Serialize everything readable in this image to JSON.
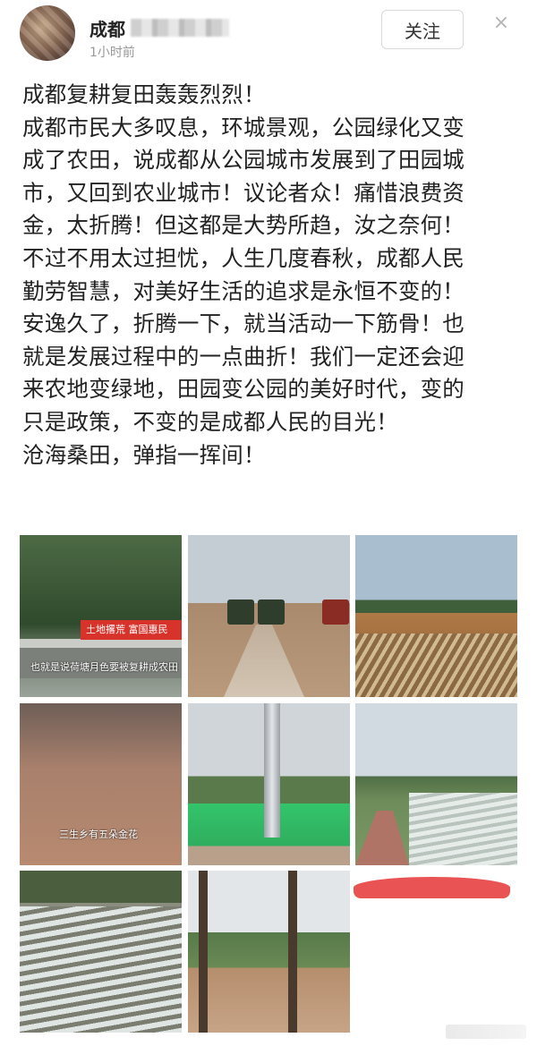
{
  "post": {
    "username": "成都",
    "time": "1小时前",
    "follow_label": "关注",
    "close_glyph": "×"
  },
  "content": {
    "lines": [
      "成都复耕复田轰轰烈烈！",
      "成都市民大多叹息，环城景观，公园绿化又变",
      "成了农田，说成都从公园城市发展到了田园城",
      "市，又回到农业城市！议论者众！痛惜浪费资",
      "金，太折腾！但这都是大势所趋，汝之奈何！",
      "不过不用太过担忧，人生几度春秋，成都人民",
      "勤劳智慧，对美好生活的追求是永恒不变的！",
      "安逸久了，折腾一下，就当活动一下筋骨！也",
      "就是发展过程中的一点曲折！我们一定还会迎",
      "来农地变绿地，田园变公园的美好时代，变的",
      "只是政策，不变的是成都人民的目光！",
      "沧海桑田，弹指一挥间！"
    ]
  },
  "images": {
    "tile1_banner": "土地撂荒 富国惠民",
    "tile1_caption": "也就是说荷塘月色要被复耕成农田",
    "tile4_caption": "三生乡有五朵金花"
  },
  "icons": {
    "close": "close-icon"
  }
}
